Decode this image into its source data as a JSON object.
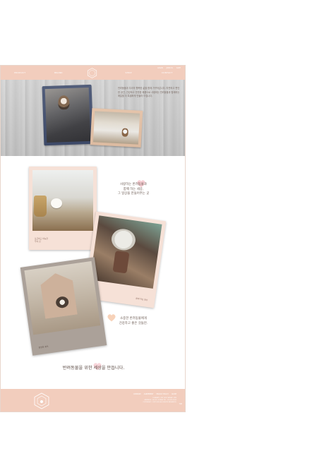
{
  "header": {
    "util_links": [
      "LOGIN",
      "JOIN US",
      "CART"
    ],
    "nav": [
      "PRODUCT",
      "BRAND",
      "SHOP",
      "CONTACT"
    ],
    "logo_icon": "hexagon-paw-logo"
  },
  "hero": {
    "text": "반려동물과 우리의 행복한 삶을 함께 가꾸어갑니다. 따뜻하고 편안한 공간, 건강하고 안전한 제품으로 사랑하는 반려동물과 함께하는 매일을 더 특별하게 만들어 드립니다."
  },
  "photos": {
    "p1_caption_1": "포근하고 아늑한",
    "p1_caption_2": "우리 집",
    "p2_caption": "함께 하는 일상",
    "p3_caption": "편안한 휴식"
  },
  "notes": {
    "n1_line1": "사랑하는 반려동물과",
    "n1_line2": "함께 하는 세상,",
    "n1_line3": "그 일상을 만들어주는 곳",
    "n2_line1": "소중한 반려동물에게",
    "n2_line2": "건강하고 좋은 것들만."
  },
  "slogan": "반려동물을 위한 세상을 만듭니다.",
  "footer": {
    "links": [
      "COMPANY",
      "AGREEMENT",
      "PRIVACY POLICY",
      "GUIDE"
    ],
    "info_1": "COMPANY : PET LIFE  OWNER : KIM",
    "info_2": "ADDRESS : SEOUL, KOREA  TEL : 02-000-0000",
    "info_3": "COPYRIGHT © PET LIFE ALL RIGHTS RESERVED.",
    "page": "TOP"
  },
  "colors": {
    "brand_peach": "#f2cdbd",
    "stamp_navy": "#3d4a6b",
    "heart_pink": "#f3b9c2"
  }
}
